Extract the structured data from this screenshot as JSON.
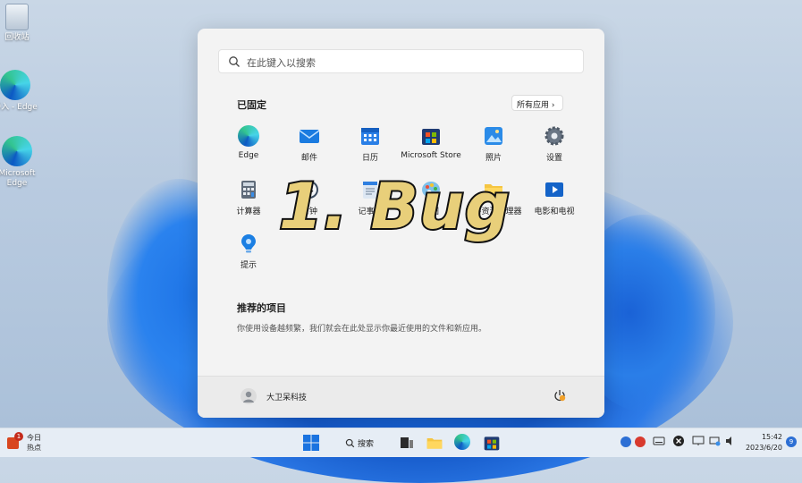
{
  "desktop": {
    "icons": [
      {
        "label": "回收站"
      },
      {
        "label": "导入 - Edge"
      },
      {
        "label": "Microsoft Edge"
      }
    ]
  },
  "start_menu": {
    "search_placeholder": "在此键入以搜索",
    "pinned_title": "已固定",
    "all_apps_label": "所有应用 ›",
    "pinned_apps": [
      {
        "label": "Edge",
        "icon": "edge-icon"
      },
      {
        "label": "邮件",
        "icon": "mail-icon"
      },
      {
        "label": "日历",
        "icon": "calendar-icon"
      },
      {
        "label": "Microsoft Store",
        "icon": "store-icon"
      },
      {
        "label": "照片",
        "icon": "photos-icon"
      },
      {
        "label": "设置",
        "icon": "settings-icon"
      },
      {
        "label": "计算器",
        "icon": "calculator-icon"
      },
      {
        "label": "时钟",
        "icon": "clock-icon"
      },
      {
        "label": "记事本",
        "icon": "notepad-icon"
      },
      {
        "label": "画图",
        "icon": "paint-icon"
      },
      {
        "label": "文件资源管理器",
        "icon": "folder-icon"
      },
      {
        "label": "电影和电视",
        "icon": "movies-icon"
      },
      {
        "label": "提示",
        "icon": "tips-icon"
      }
    ],
    "recommended_title": "推荐的项目",
    "recommended_text": "你使用设备越频繁，我们就会在此处显示你最近使用的文件和新应用。",
    "user_name": "大卫呆科技"
  },
  "overlay_caption": "1. Bug",
  "taskbar": {
    "news_line1": "今日",
    "news_line2": "热点",
    "news_badge": "1",
    "search_label": "搜索",
    "time": "15:42",
    "date": "2023/6/20",
    "notification_count": "9"
  },
  "colors": {
    "accent": "#0a64d8",
    "menu_bg": "#f3f3f3",
    "taskbar_bg": "#e6edf5",
    "overlay_fill": "#e8cf7a"
  }
}
